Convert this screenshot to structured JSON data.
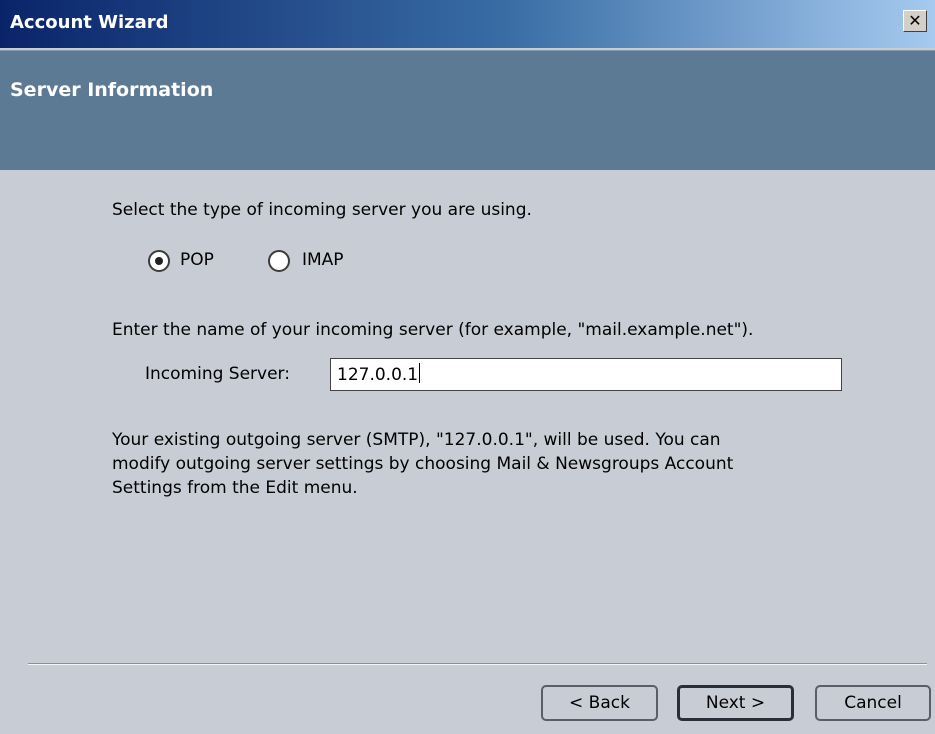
{
  "window": {
    "title": "Account Wizard",
    "close_glyph": "✕",
    "close_icon": "close-icon"
  },
  "header": {
    "heading": "Server Information"
  },
  "server_type": {
    "prompt": "Select the type of incoming server you are using.",
    "options": [
      {
        "label": "POP",
        "selected": true
      },
      {
        "label": "IMAP",
        "selected": false
      }
    ]
  },
  "incoming": {
    "prompt": "Enter the name of your incoming server (for example, \"mail.example.net\").",
    "label": "Incoming Server:",
    "value": "127.0.0.1"
  },
  "info": {
    "lines": [
      "Your existing outgoing server (SMTP), \"127.0.0.1\", will be used. You can",
      "modify outgoing server settings by choosing Mail & Newsgroups Account",
      "Settings from the Edit menu."
    ]
  },
  "buttons": {
    "back": "< Back",
    "next": "Next >",
    "cancel": "Cancel"
  }
}
